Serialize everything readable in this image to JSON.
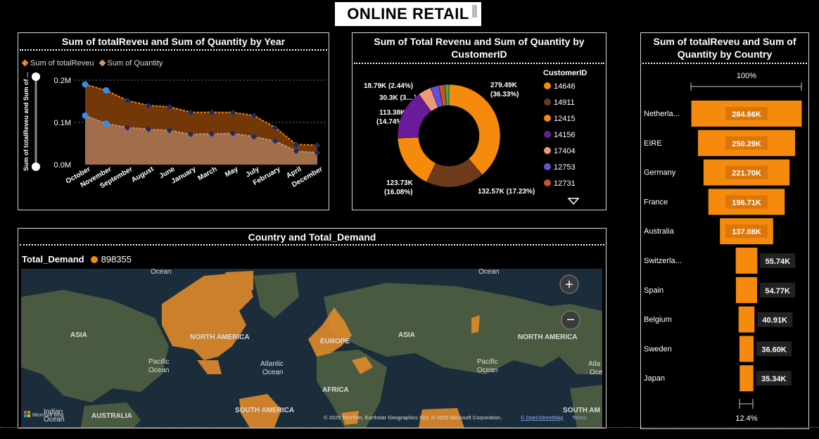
{
  "header": {
    "title": "ONLINE RETAIL"
  },
  "year_chart": {
    "title": "Sum of totalReveu and Sum of Quantity by Year",
    "legend": [
      {
        "label": "Sum of totalReveu",
        "color": "#f28a1e"
      },
      {
        "label": "Sum of Quantity",
        "color": "#c79a72"
      }
    ],
    "ylabel": "Sum of totalReveu and Sum of ...",
    "yticks": [
      "0.2M",
      "0.1M",
      "0.0M"
    ]
  },
  "customer_chart": {
    "title": "Sum of Total Revenu and Sum of Quantity by CustomerID",
    "legend_title": "CustomerID",
    "labels": {
      "l1": "279.49K",
      "l1b": "(36.33%)",
      "l2": "132.57K (17.23%)",
      "l3": "123.73K",
      "l3b": "(16.08%)",
      "l4": "113.38K",
      "l4b": "(14.74%)",
      "l5": "30.3K (3....)",
      "l6": "18.79K (2.44%)"
    }
  },
  "country_chart": {
    "title": "Sum of totalReveu and Sum of Quantity by Country",
    "top_pct": "100%",
    "bottom_pct": "12.4%"
  },
  "map_panel": {
    "title": "Country and Total_Demand",
    "legend_label": "Total_Demand",
    "legend_value": "898355",
    "zoom_in": "+",
    "zoom_out": "−",
    "labels": {
      "ocean1": "Ocean",
      "ocean2": "Ocean",
      "asia1": "ASIA",
      "na1": "NORTH AMERICA",
      "europe": "EUROPE",
      "asia2": "ASIA",
      "na2": "NORTH AMERICA",
      "pacific1a": "Pacific",
      "pacific1b": "Ocean",
      "atlantic_a": "Atlantic",
      "atlantic_b": "Ocean",
      "pacific2a": "Pacific",
      "pacific2b": "Ocean",
      "atl2a": "Atla",
      "atl2b": "Oce",
      "africa": "AFRICA",
      "indian_a": "Indian",
      "indian_b": "Ocean",
      "australia": "AUSTRALIA",
      "sa1": "SOUTH AMERICA",
      "sa2": "SOUTH AM",
      "bing": "Microsoft Bing",
      "copyright": "© 2025 TomTom, Earthstar Geographics SIO, © 2025 Microsoft Corporation,",
      "osm": "© OpenStreetMap",
      "terms": "Terms"
    }
  },
  "chart_data": [
    {
      "type": "area",
      "title": "Sum of totalReveu and Sum of Quantity by Year",
      "ylabel": "Sum of totalReveu and Sum of ...",
      "ylim": [
        0,
        200000
      ],
      "categories": [
        "October",
        "November",
        "September",
        "August",
        "June",
        "January",
        "March",
        "May",
        "July",
        "February",
        "April",
        "December"
      ],
      "series": [
        {
          "name": "Sum of totalReveu",
          "values": [
            190000,
            176000,
            152000,
            140000,
            137000,
            124000,
            124000,
            124000,
            116000,
            88000,
            48000,
            46000
          ]
        },
        {
          "name": "Sum of Quantity",
          "values": [
            116000,
            97000,
            88000,
            84000,
            81000,
            72000,
            73000,
            74000,
            66000,
            56000,
            32000,
            28000
          ]
        }
      ],
      "grid": true,
      "legend": "top-left"
    },
    {
      "type": "pie",
      "title": "Sum of Total Revenu and Sum of Quantity by CustomerID",
      "legend_title": "CustomerID",
      "categories": [
        "14646",
        "14911",
        "12415",
        "14156",
        "17404",
        "12753",
        "12731"
      ],
      "values": [
        279490,
        132570,
        123730,
        113380,
        30300,
        18790,
        14000
      ],
      "colors": [
        "#f58a0c",
        "#6e3a1c",
        "#f58a0c",
        "#6a1b9a",
        "#f0987a",
        "#6a4fd6",
        "#c2562a"
      ],
      "legend": "right"
    },
    {
      "type": "bar",
      "title": "Sum of totalReveu and Sum of Quantity by Country",
      "categories": [
        "Netherla...",
        "EIRE",
        "Germany",
        "France",
        "Australia",
        "Switzerla...",
        "Spain",
        "Belgium",
        "Sweden",
        "Japan"
      ],
      "values": [
        284660,
        250290,
        221700,
        196710,
        137080,
        55740,
        54770,
        40910,
        36600,
        35340
      ],
      "value_labels": [
        "284.66K",
        "250.29K",
        "221.70K",
        "196.71K",
        "137.08K",
        "55.74K",
        "54.77K",
        "40.91K",
        "36.60K",
        "35.34K"
      ],
      "color": "#f58a0c"
    }
  ]
}
